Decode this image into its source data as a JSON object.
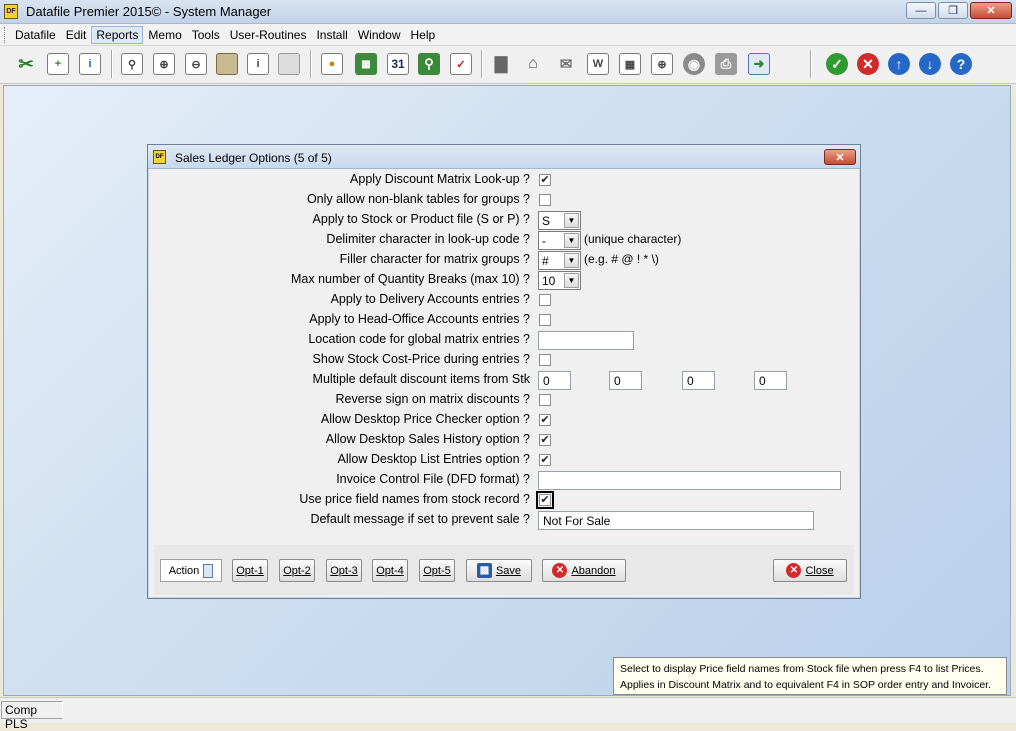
{
  "window": {
    "title": "Datafile  Premier 2015© - System Manager",
    "icon_text": "DF"
  },
  "menu": [
    "Datafile",
    "Edit",
    "Reports",
    "Memo",
    "Tools",
    "User-Routines",
    "Install",
    "Window",
    "Help"
  ],
  "toolbar_icons": [
    "cut-icon",
    "add-document-icon",
    "document-info-icon",
    "preview-icon",
    "add-table-icon",
    "remove-table-icon",
    "box-icon",
    "info-box-icon",
    "eraser-icon",
    "document-lock-icon",
    "calculator-icon",
    "calendar-icon",
    "magnifier-books-icon",
    "checklist-icon",
    "bar-chart-icon",
    "house-icon",
    "mail-icon",
    "word-doc-icon",
    "picture-icon",
    "add-window-icon",
    "disk-icon",
    "printer-icon",
    "export-icon",
    "ok-icon",
    "cancel-icon",
    "up-icon",
    "down-icon",
    "help-icon"
  ],
  "toolbar_glyphs": {
    "calendar": "31"
  },
  "dialog": {
    "title": "Sales Ledger Options (5 of 5)",
    "fields": {
      "f1": "Apply Discount Matrix Look-up ?",
      "f2": "Only allow non-blank tables for groups ?",
      "f3": "Apply to Stock or Product file (S or P) ?",
      "f4": "Delimiter character in look-up code ?",
      "f5": "Filler character for matrix groups ?",
      "f6": "Max number of Quantity Breaks (max 10) ?",
      "f7": "Apply to Delivery Accounts entries ?",
      "f8": "Apply to Head-Office Accounts entries ?",
      "f9": "Location code for global matrix entries ?",
      "f10": "Show Stock Cost-Price during entries ?",
      "f11": "Multiple default discount items from Stk",
      "f12": "Reverse sign on matrix discounts ?",
      "f13": "Allow Desktop Price Checker option ?",
      "f14": "Allow Desktop Sales History option ?",
      "f15": "Allow Desktop List Entries option ?",
      "f16": "Invoice Control File (DFD format) ?",
      "f17": "Use price field names from stock record ?",
      "f18": "Default message if set to prevent sale ?"
    },
    "values": {
      "stock_or_product": "S",
      "delimiter": "-",
      "delimiter_note": "(unique character)",
      "filler": "#",
      "filler_note": "(e.g. # @ ! * \\)",
      "max_breaks": "10",
      "location_code": "",
      "discount_items": [
        "0",
        "0",
        "0",
        "0"
      ],
      "invoice_control_file": "",
      "default_message": "Not For Sale"
    },
    "checks": {
      "f1": true,
      "f2": false,
      "f7": false,
      "f8": false,
      "f10": false,
      "f12": false,
      "f13": true,
      "f14": true,
      "f15": true,
      "f17": true
    },
    "buttons": {
      "action": "Action",
      "opt1": "Opt-1",
      "opt2": "Opt-2",
      "opt3": "Opt-3",
      "opt4": "Opt-4",
      "opt5": "Opt-5",
      "save": "Save",
      "abandon": "Abandon",
      "close": "Close"
    }
  },
  "hint": {
    "line1": "Select to display Price field names from Stock file when press F4 to list Prices.",
    "line2": "Applies in Discount Matrix and to equivalent F4 in SOP order entry and Invoicer."
  },
  "status": {
    "company": "Comp PLS"
  }
}
